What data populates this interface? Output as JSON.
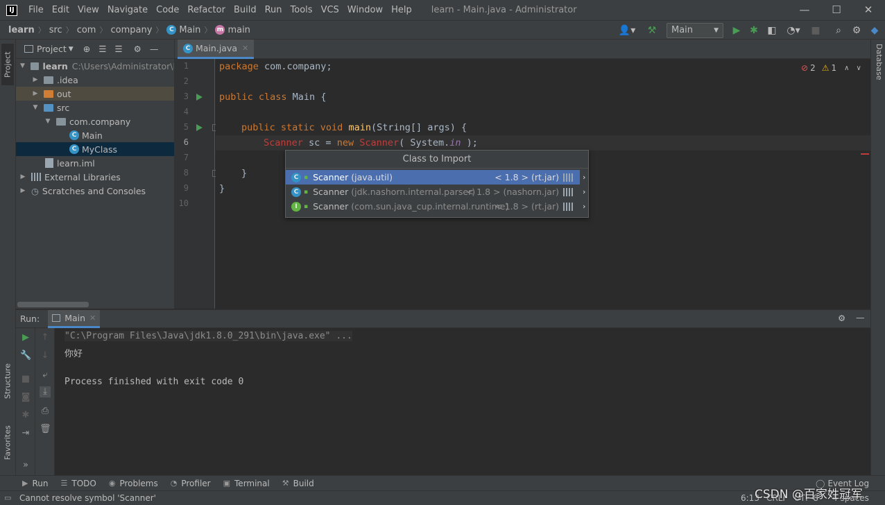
{
  "app": {
    "title": "learn - Main.java - Administrator",
    "logo": "IJ"
  },
  "menu": [
    "File",
    "Edit",
    "View",
    "Navigate",
    "Code",
    "Refactor",
    "Build",
    "Run",
    "Tools",
    "VCS",
    "Window",
    "Help"
  ],
  "breadcrumbs": [
    "learn",
    "src",
    "com",
    "company",
    "Main",
    "main"
  ],
  "toolbar": {
    "run_config": "Main"
  },
  "left_strip": {
    "project": "Project",
    "structure": "Structure",
    "favorites": "Favorites"
  },
  "right_strip": {
    "database": "Database"
  },
  "project_panel": {
    "title": "Project",
    "tree": [
      {
        "label": "learn",
        "detail": "C:\\Users\\Administrator\\De"
      },
      {
        "label": ".idea"
      },
      {
        "label": "out"
      },
      {
        "label": "src"
      },
      {
        "label": "com.company"
      },
      {
        "label": "Main"
      },
      {
        "label": "MyClass"
      },
      {
        "label": "learn.iml"
      },
      {
        "label": "External Libraries"
      },
      {
        "label": "Scratches and Consoles"
      }
    ]
  },
  "editor": {
    "tab": "Main.java",
    "errors": "2",
    "warnings": "1",
    "line_numbers": [
      "1",
      "2",
      "3",
      "4",
      "5",
      "6",
      "7",
      "8",
      "9",
      "10"
    ],
    "code": {
      "l1_kw": "package",
      "l1_rest": " com.company;",
      "l3_kw": "public class",
      "l3_rest": " Main {",
      "l5_kw": "public static void",
      "l5_fn": "main",
      "l5_rest": "(String[] args) {",
      "l6_err1": "Scanner",
      "l6_mid": " sc = ",
      "l6_kw": "new",
      "l6_err2": "Scanner",
      "l6_mid2": "( System.",
      "l6_fld": "in",
      "l6_end": " );",
      "l8": "}",
      "l9": "}"
    }
  },
  "import_popup": {
    "title": "Class to Import",
    "items": [
      {
        "name": "Scanner",
        "pkg": "(java.util)",
        "jar": "< 1.8 > (rt.jar)",
        "kind": "C"
      },
      {
        "name": "Scanner",
        "pkg": "(jdk.nashorn.internal.parser)",
        "jar": "< 1.8 > (nashorn.jar)",
        "kind": "C"
      },
      {
        "name": "Scanner",
        "pkg": "(com.sun.java_cup.internal.runtime)",
        "jar": "< 1.8 > (rt.jar)",
        "kind": "I"
      }
    ]
  },
  "run_panel": {
    "label": "Run:",
    "tab": "Main",
    "console": [
      "\"C:\\Program Files\\Java\\jdk1.8.0_291\\bin\\java.exe\" ...",
      "你好",
      "",
      "Process finished with exit code 0"
    ]
  },
  "bottom_tools": [
    "Run",
    "TODO",
    "Problems",
    "Profiler",
    "Terminal",
    "Build"
  ],
  "event_log": "Event Log",
  "status": {
    "message": "Cannot resolve symbol 'Scanner'",
    "position": "6:13",
    "line_sep": "CRLF",
    "encoding": "UTF-8",
    "indent": "4 spaces"
  },
  "watermark": "CSDN @百家姓冠军"
}
